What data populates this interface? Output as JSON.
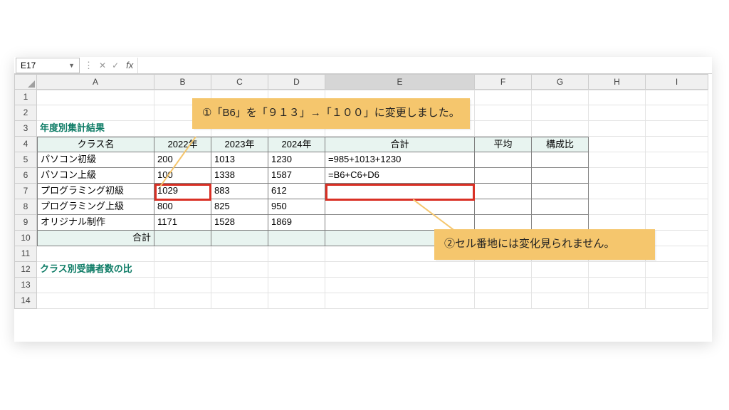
{
  "namebox": "E17",
  "fx_label": "fx",
  "formula_value": "",
  "columns": [
    "A",
    "B",
    "C",
    "D",
    "E",
    "F",
    "G",
    "H",
    "I"
  ],
  "row_numbers": [
    1,
    2,
    3,
    4,
    5,
    6,
    7,
    8,
    9,
    10,
    11,
    12,
    13,
    14
  ],
  "section_title_row3": "年度別集計結果",
  "section_title_row12": "クラス別受講者数の比",
  "headers": {
    "class": "クラス名",
    "y2022": "2022年",
    "y2023": "2023年",
    "y2024": "2024年",
    "total": "合計",
    "avg": "平均",
    "ratio": "構成比"
  },
  "rows": [
    {
      "name": "パソコン初級",
      "y22": "200",
      "y23": "1013",
      "y24": "1230",
      "e": "=985+1013+1230"
    },
    {
      "name": "パソコン上級",
      "y22": "100",
      "y23": "1338",
      "y24": "1587",
      "e": "=B6+C6+D6"
    },
    {
      "name": "プログラミング初級",
      "y22": "1029",
      "y23": "883",
      "y24": "612",
      "e": ""
    },
    {
      "name": "プログラミング上級",
      "y22": "800",
      "y23": "825",
      "y24": "950",
      "e": ""
    },
    {
      "name": "オリジナル制作",
      "y22": "1171",
      "y23": "1528",
      "y24": "1869",
      "e": ""
    }
  ],
  "grand_total_label": "合計",
  "callout1": "①「B6」を「９１３」→「１００」に変更しました。",
  "callout2": "②セル番地には変化見られません。",
  "colors": {
    "accent": "#0e7c66",
    "hlred": "#d93025",
    "note": "#f5c66d"
  }
}
